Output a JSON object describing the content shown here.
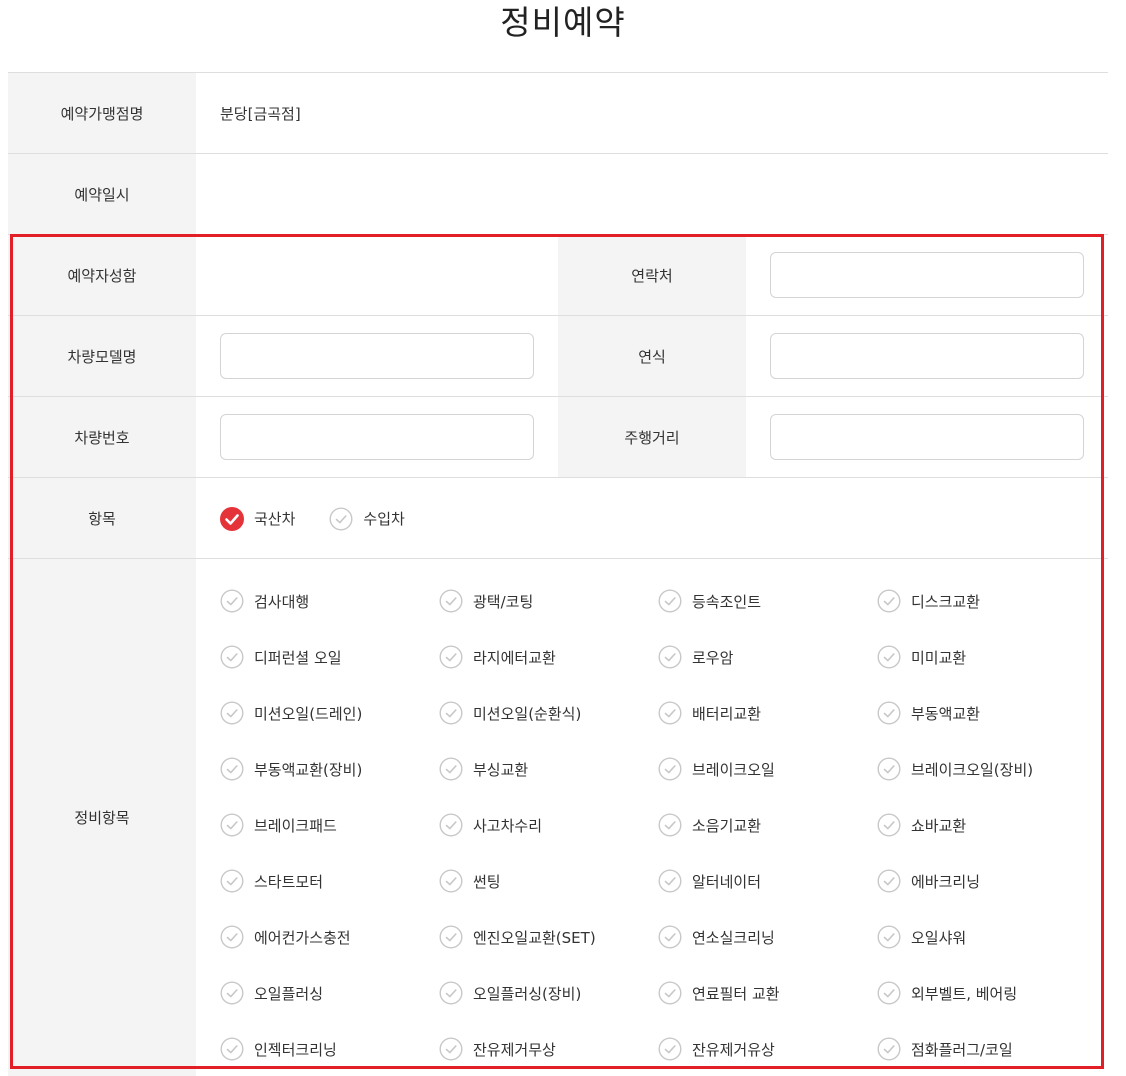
{
  "page_title": "정비예약",
  "fields": {
    "store_label": "예약가맹점명",
    "store_value": "분당[금곡점]",
    "datetime_label": "예약일시",
    "datetime_value": "",
    "name_label": "예약자성함",
    "contact_label": "연락처",
    "model_label": "차량모델명",
    "year_label": "연식",
    "plate_label": "차량번호",
    "mileage_label": "주행거리",
    "category_label": "항목",
    "service_label": "정비항목"
  },
  "category_options": [
    {
      "label": "국산차",
      "checked": true
    },
    {
      "label": "수입차",
      "checked": false
    }
  ],
  "service_items": [
    "검사대행",
    "광택/코팅",
    "등속조인트",
    "디스크교환",
    "디퍼런셜 오일",
    "라지에터교환",
    "로우암",
    "미미교환",
    "미션오일(드레인)",
    "미션오일(순환식)",
    "배터리교환",
    "부동액교환",
    "부동액교환(장비)",
    "부싱교환",
    "브레이크오일",
    "브레이크오일(장비)",
    "브레이크패드",
    "사고차수리",
    "소음기교환",
    "쇼바교환",
    "스타트모터",
    "썬팅",
    "알터네이터",
    "에바크리닝",
    "에어컨가스충전",
    "엔진오일교환(SET)",
    "연소실크리닝",
    "오일샤워",
    "오일플러싱",
    "오일플러싱(장비)",
    "연료필터 교환",
    "외부벨트, 베어링",
    "인젝터크리닝",
    "잔유제거무상",
    "잔유제거유상",
    "점화플러그/코일"
  ],
  "colors": {
    "accent": "#e4343a",
    "highlight_border": "#e21f26",
    "header_bg": "#f4f4f4",
    "unchecked": "#c8c8c8"
  }
}
